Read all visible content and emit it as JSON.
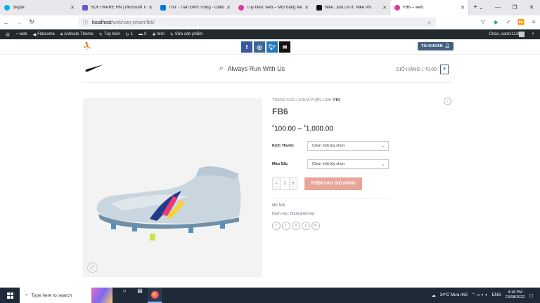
{
  "tabs": [
    {
      "label": "Skype",
      "color": "#00aff0"
    },
    {
      "label": "SOFTWARE HN | Microsoft Tea",
      "color": "#5b5fc7"
    },
    {
      "label": "Thư - Trần Đình Trọng - Outloo",
      "color": "#0078d4"
    },
    {
      "label": "Tùy biến: web – Một trang web",
      "color": "#d63ba0"
    },
    {
      "label": "Nike. Just Do It. Nike VN",
      "color": "#111111"
    },
    {
      "label": "FB6 – web",
      "color": "#d63ba0"
    }
  ],
  "browser": {
    "url_host": "localhost",
    "url_path": "/web/san-pham/fb6/"
  },
  "admin": {
    "site": "web",
    "theme": "Flatsome",
    "activate": "Activate Theme",
    "customize": "Tùy biến",
    "updates": "1",
    "comments": "0",
    "new": "Mới",
    "edit": "Sửa sản phẩm",
    "greeting": "Chào, sam2112k"
  },
  "topbar": {
    "account": "TÀI KHOẢN"
  },
  "header": {
    "search_text": "Always Run With Us",
    "cart_label": "GIỎ HÀNG / ₫0.00",
    "cart_count": "0"
  },
  "product": {
    "breadcrumb_home": "TRANG CHỦ",
    "breadcrumb_cat": "CHƯA PHÂN LOẠI",
    "breadcrumb_cur": "FB6",
    "title": "FB6",
    "price_from": "100.00",
    "price_to": "1,000.00",
    "currency": "₫",
    "size_label": "Kích Thước",
    "size_value": "Chọn một tùy chọn",
    "color_label": "Màu Sắc",
    "color_value": "Chọn một tùy chọn",
    "qty": "1",
    "add_to_cart": "THÊM VÀO GIỎ HÀNG",
    "sku_label": "Mã: N/A",
    "cat_label": "Danh mục:",
    "cat_value": "Chưa phân loại"
  },
  "taskbar": {
    "search_placeholder": "Type here to search",
    "weather": "34°C  Mưa nhỏ",
    "lang": "ENG",
    "time": "4:18 PM",
    "date": "23/08/2022"
  },
  "colors": {
    "accent": "#446084",
    "button": "#e8a59a"
  }
}
